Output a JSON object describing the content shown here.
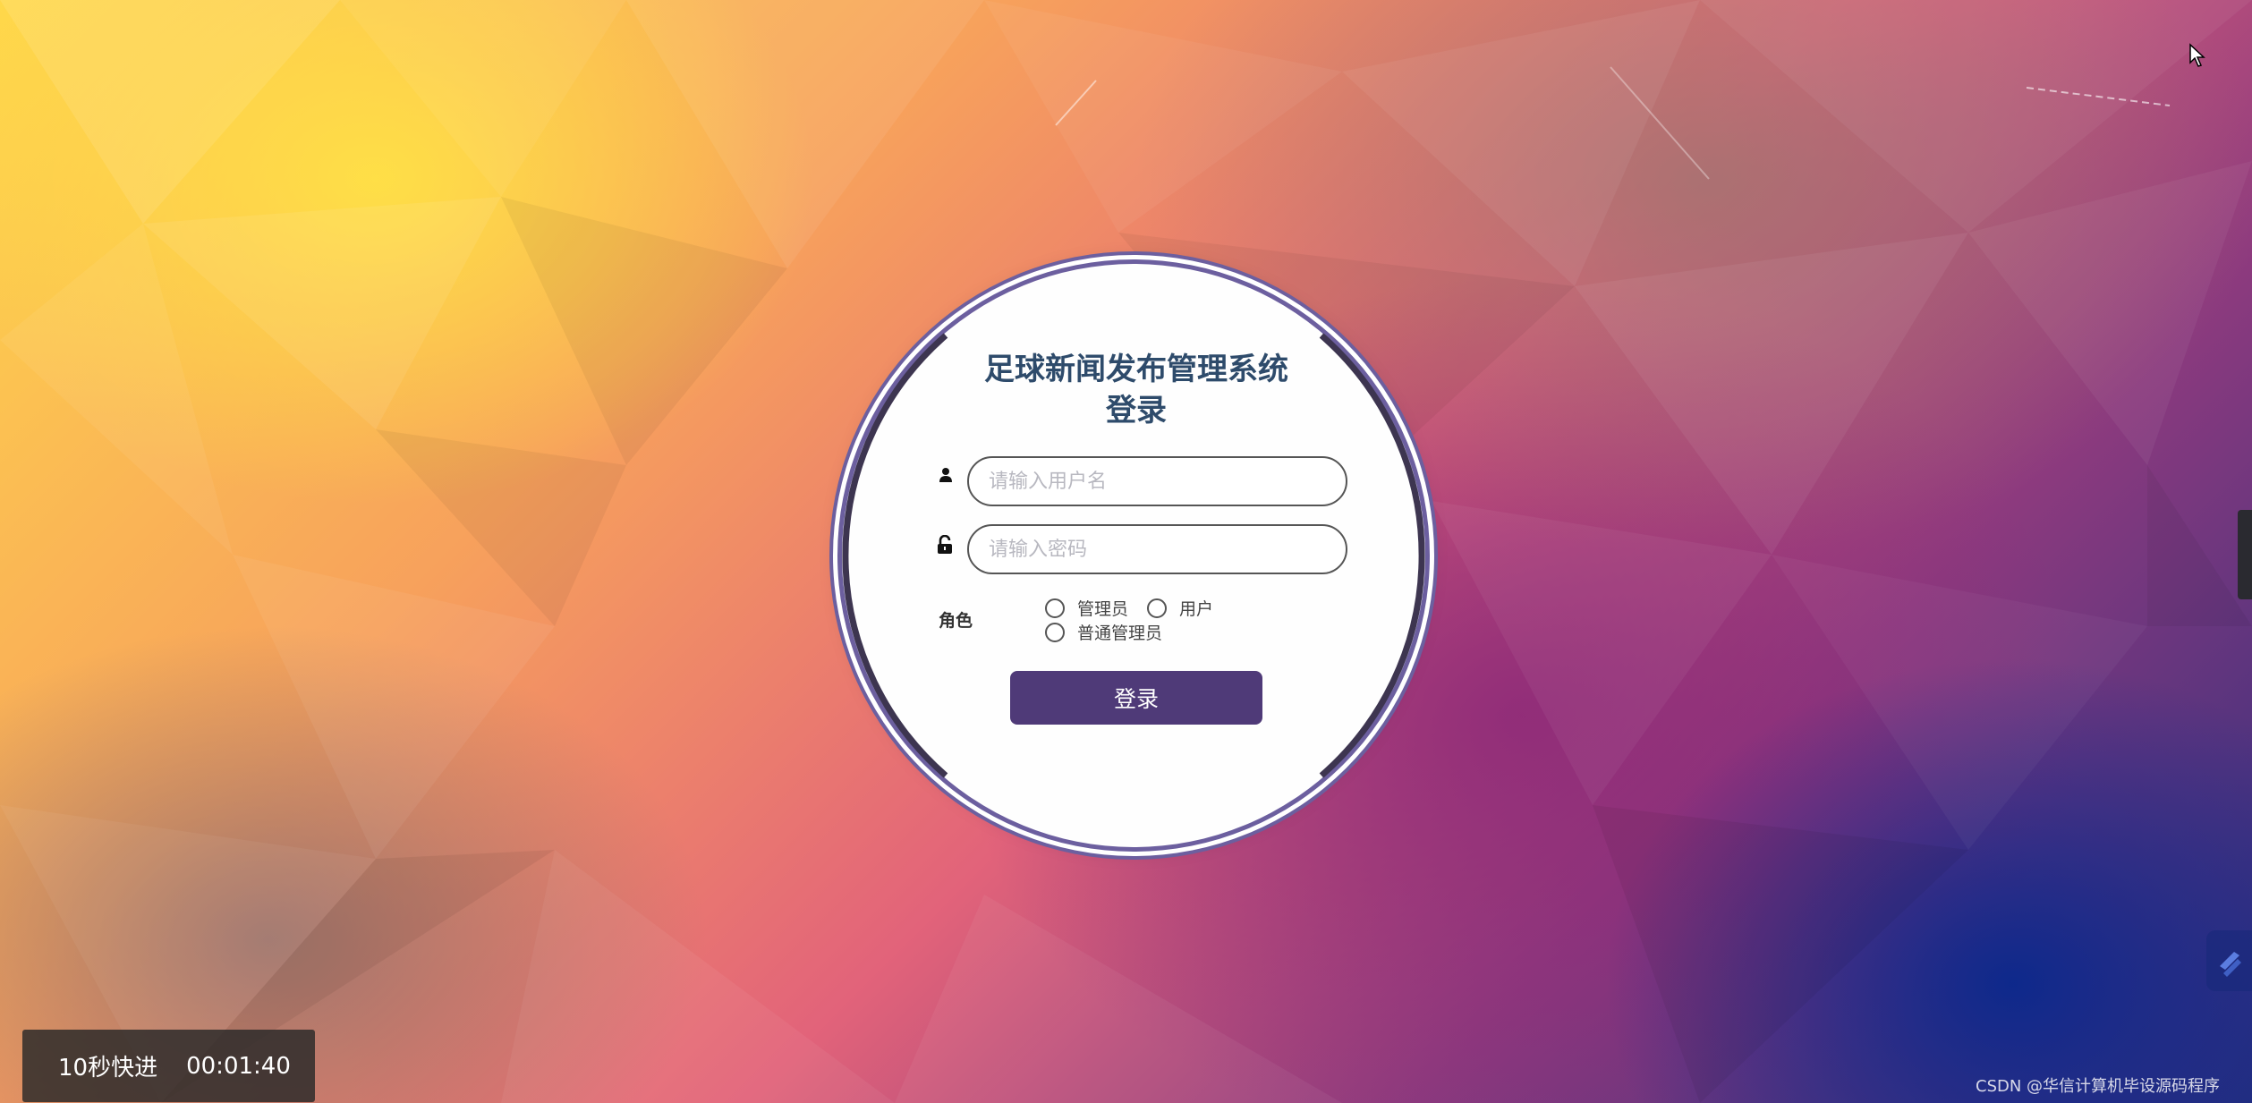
{
  "login": {
    "title_line1": "足球新闻发布管理系统",
    "title_line2": "登录",
    "username_placeholder": "请输入用户名",
    "password_placeholder": "请输入密码",
    "role_label": "角色",
    "roles": [
      "管理员",
      "用户",
      "普通管理员"
    ],
    "submit_label": "登录"
  },
  "player": {
    "fast_forward_label": "10秒快进",
    "elapsed_time": "00:01:40"
  },
  "watermark": "CSDN @华信计算机毕设源码程序",
  "colors": {
    "title": "#2e4b6b",
    "button": "#4f3a78",
    "ring": "#6c5f9f"
  },
  "icons": [
    "user-icon",
    "lock-icon",
    "cursor-icon",
    "side-logo-icon"
  ]
}
